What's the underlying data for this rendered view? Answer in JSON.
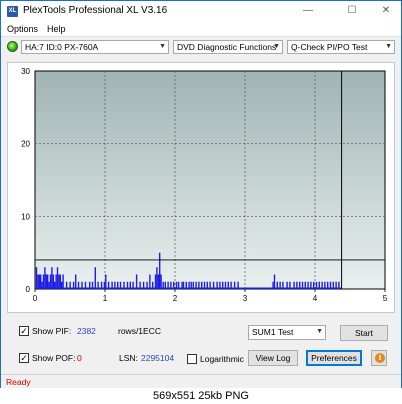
{
  "window": {
    "title": "PlexTools Professional XL V3.16",
    "app_icon_text": "XL",
    "minimize_glyph": "—",
    "maximize_glyph": "☐",
    "close_glyph": "✕"
  },
  "menu": {
    "items": [
      {
        "label": "Options"
      },
      {
        "label": "Help"
      }
    ]
  },
  "toolbar": {
    "drive": "HA:7 ID:0  PX-760A",
    "function": "DVD Diagnostic Functions",
    "test": "Q-Check PI/PO Test",
    "drive_status_color": "#3aa312"
  },
  "chart_data": {
    "type": "bar",
    "xlim": [
      0,
      5
    ],
    "ylim": [
      0,
      30
    ],
    "x_ticks": [
      "0",
      "1",
      "2",
      "3",
      "4",
      "5"
    ],
    "y_ticks": [
      "0",
      "10",
      "20",
      "30"
    ],
    "threshold": 4,
    "end_marker_x": 4.38,
    "grid": true,
    "bar_color": "#1d1de6",
    "background_gradient": [
      "#eaf0ef",
      "#9fb4b4"
    ],
    "bars": [
      [
        0.02,
        3
      ],
      [
        0.04,
        2
      ],
      [
        0.06,
        2
      ],
      [
        0.08,
        2
      ],
      [
        0.1,
        1
      ],
      [
        0.12,
        2
      ],
      [
        0.14,
        3
      ],
      [
        0.16,
        2
      ],
      [
        0.18,
        2
      ],
      [
        0.2,
        1
      ],
      [
        0.22,
        2
      ],
      [
        0.24,
        3
      ],
      [
        0.26,
        2
      ],
      [
        0.28,
        1
      ],
      [
        0.3,
        2
      ],
      [
        0.32,
        3
      ],
      [
        0.34,
        2
      ],
      [
        0.36,
        2
      ],
      [
        0.38,
        1
      ],
      [
        0.4,
        2
      ],
      [
        0.45,
        1
      ],
      [
        0.5,
        1
      ],
      [
        0.55,
        1
      ],
      [
        0.58,
        2
      ],
      [
        0.62,
        1
      ],
      [
        0.67,
        1
      ],
      [
        0.72,
        1
      ],
      [
        0.78,
        1
      ],
      [
        0.82,
        1
      ],
      [
        0.86,
        3
      ],
      [
        0.9,
        1
      ],
      [
        0.95,
        1
      ],
      [
        0.99,
        1
      ],
      [
        1.01,
        2
      ],
      [
        1.05,
        1
      ],
      [
        1.1,
        1
      ],
      [
        1.14,
        1
      ],
      [
        1.18,
        1
      ],
      [
        1.22,
        1
      ],
      [
        1.27,
        1
      ],
      [
        1.32,
        1
      ],
      [
        1.36,
        1
      ],
      [
        1.4,
        1
      ],
      [
        1.45,
        2
      ],
      [
        1.5,
        1
      ],
      [
        1.55,
        1
      ],
      [
        1.6,
        1
      ],
      [
        1.64,
        2
      ],
      [
        1.68,
        1
      ],
      [
        1.72,
        2
      ],
      [
        1.74,
        3
      ],
      [
        1.76,
        2
      ],
      [
        1.78,
        5
      ],
      [
        1.8,
        2
      ],
      [
        1.83,
        1
      ],
      [
        1.86,
        1
      ],
      [
        1.9,
        1
      ],
      [
        1.94,
        1
      ],
      [
        1.98,
        1
      ],
      [
        2.02,
        1
      ],
      [
        2.05,
        1
      ],
      [
        2.1,
        1
      ],
      [
        2.12,
        1
      ],
      [
        2.16,
        1
      ],
      [
        2.2,
        1
      ],
      [
        2.23,
        1
      ],
      [
        2.26,
        1
      ],
      [
        2.3,
        1
      ],
      [
        2.34,
        1
      ],
      [
        2.38,
        1
      ],
      [
        2.42,
        1
      ],
      [
        2.46,
        1
      ],
      [
        2.5,
        1
      ],
      [
        2.55,
        1
      ],
      [
        2.6,
        1
      ],
      [
        2.64,
        1
      ],
      [
        2.68,
        1
      ],
      [
        2.72,
        1
      ],
      [
        2.76,
        1
      ],
      [
        2.8,
        1
      ],
      [
        2.85,
        1
      ],
      [
        2.9,
        1
      ],
      [
        3.4,
        1
      ],
      [
        3.42,
        2
      ],
      [
        3.46,
        1
      ],
      [
        3.5,
        1
      ],
      [
        3.54,
        1
      ],
      [
        3.6,
        1
      ],
      [
        3.64,
        1
      ],
      [
        3.7,
        1
      ],
      [
        3.74,
        1
      ],
      [
        3.78,
        1
      ],
      [
        3.82,
        1
      ],
      [
        3.86,
        1
      ],
      [
        3.9,
        1
      ],
      [
        3.94,
        1
      ],
      [
        3.98,
        1
      ],
      [
        4.02,
        1
      ],
      [
        4.06,
        1
      ],
      [
        4.1,
        1
      ],
      [
        4.14,
        1
      ],
      [
        4.18,
        1
      ],
      [
        4.22,
        1
      ],
      [
        4.26,
        1
      ],
      [
        4.3,
        1
      ],
      [
        4.34,
        1
      ]
    ]
  },
  "bottom": {
    "show_pif_label": "Show PIF:",
    "pif_value": "2382",
    "pif_unit": "rows/1ECC",
    "show_pof_label": "Show POF:",
    "pof_value": "0",
    "lsn_label": "LSN:",
    "lsn_value": "2295104",
    "logarithmic_label": "Logarithmic",
    "mode_select": "SUM1 Test",
    "start_label": "Start",
    "view_log_label": "View Log",
    "preferences_label": "Preferences",
    "check_glyph": "✓",
    "info_glyph": "i"
  },
  "status": {
    "text": "Ready"
  },
  "caption": {
    "text": "569x551  25kb  PNG"
  }
}
